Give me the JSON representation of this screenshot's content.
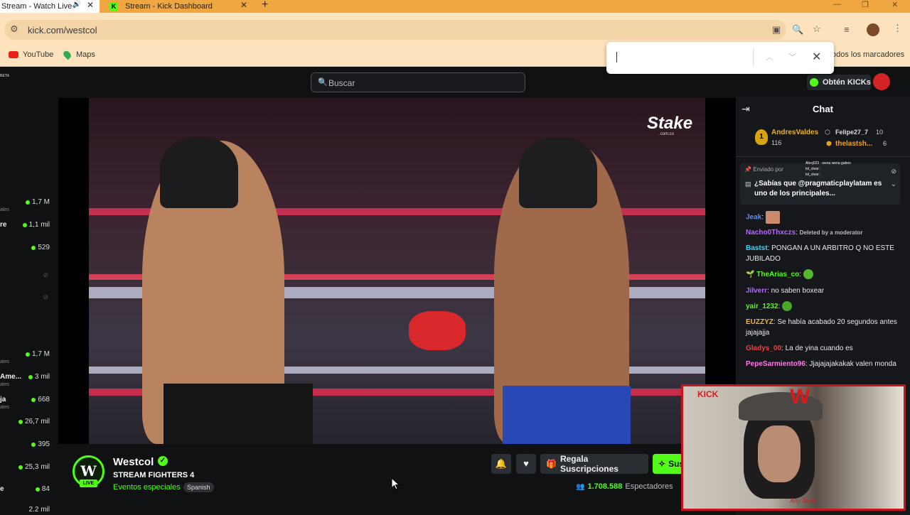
{
  "browser": {
    "tabs": [
      {
        "label": "Stream - Watch Live",
        "active": true
      },
      {
        "label": "Stream - Kick Dashboard",
        "active": false
      }
    ],
    "url": "kick.com/westcol",
    "bookmarks": [
      {
        "label": "YouTube"
      },
      {
        "label": "Maps"
      }
    ],
    "all_bookmarks": "odos los marcadores",
    "colors": {
      "tabbar": "#f0a742",
      "toolbar": "#fde3bd",
      "accent": "#53fc18"
    }
  },
  "header": {
    "search_placeholder": "Buscar",
    "get_kicks_label": "Obtén KICKs",
    "beta_badge": "BETA"
  },
  "sidebar": {
    "channels": [
      {
        "name": "",
        "sub": "ales",
        "viewers": "1,7 M"
      },
      {
        "name": "re",
        "sub": "",
        "viewers": "1,1 mil"
      },
      {
        "name": "",
        "sub": "",
        "viewers": "529"
      },
      {
        "name": "",
        "sub": "",
        "viewers": ""
      },
      {
        "name": "",
        "sub": "",
        "viewers": ""
      },
      {
        "name": "",
        "sub": "ales",
        "viewers": "1,7 M"
      },
      {
        "name": "Ame...",
        "sub": "ales",
        "viewers": "3 mil"
      },
      {
        "name": "ja",
        "sub": "ales",
        "viewers": "668"
      },
      {
        "name": "",
        "sub": "",
        "viewers": "26,7 mil"
      },
      {
        "name": "",
        "sub": "",
        "viewers": "395"
      },
      {
        "name": "",
        "sub": "",
        "viewers": "25,3 mil"
      },
      {
        "name": "e",
        "sub": "",
        "viewers": "84"
      },
      {
        "name": "",
        "sub": "",
        "viewers": "2,2 mil"
      }
    ]
  },
  "video": {
    "watermark": "Stake",
    "watermark_sub": ".com.co"
  },
  "channel": {
    "name": "Westcol",
    "title": "STREAM FIGHTERS 4",
    "category": "Eventos especiales",
    "language": "Spanish",
    "live_badge": "LIVE",
    "gift_label": "Regala Suscripciones",
    "subscribe_label": "Suscribirse",
    "viewer_count": "1.708.588",
    "viewer_label": "Espectadores"
  },
  "chat": {
    "title": "Chat",
    "leaderboard": [
      {
        "rank": "1",
        "name": "AndresValdes",
        "value": "116"
      },
      {
        "name": "Felipe27_7",
        "value": "10"
      },
      {
        "name": "thelastsh...",
        "value": "6"
      }
    ],
    "pinned": {
      "by": "Enviado por",
      "message": "¿Sabías que @pragmaticplaylatam es uno de los principales..."
    },
    "overlay_lines": [
      "Alexj023 : wena wena gaboo",
      "lol_clear :",
      "lol_clear :"
    ],
    "messages": [
      {
        "user": "Jeak",
        "text": "",
        "color": "#5b8cff"
      },
      {
        "user": "Nacho0Thxczs",
        "text": "Deleted by a moderator",
        "color": "#b667ff",
        "deleted": true
      },
      {
        "user": "Bastst",
        "text": "PONGAN A UN ARBITRO Q NO ESTE JUBILADO",
        "color": "#33d6ff"
      },
      {
        "user": "TheArias_co",
        "text": "",
        "color": "#53fc18"
      },
      {
        "user": "Jilverr",
        "text": "no saben boxear",
        "color": "#b667ff"
      },
      {
        "user": "yair_1232",
        "text": "",
        "color": "#53fc18"
      },
      {
        "user": "EUZZYZ",
        "text": "Se había acabado 20 segundos antes jajajajja",
        "color": "#f2b43a"
      },
      {
        "user": "Gladys_00",
        "text": "La de yina cuando es",
        "color": "#e0464b"
      },
      {
        "user": "PepeSarmiento96",
        "text": "Jjajajajakakak valen monda",
        "color": "#ff7ae6"
      }
    ]
  },
  "webcam": {
    "tag": "KICK",
    "signature": "Any Broli"
  }
}
